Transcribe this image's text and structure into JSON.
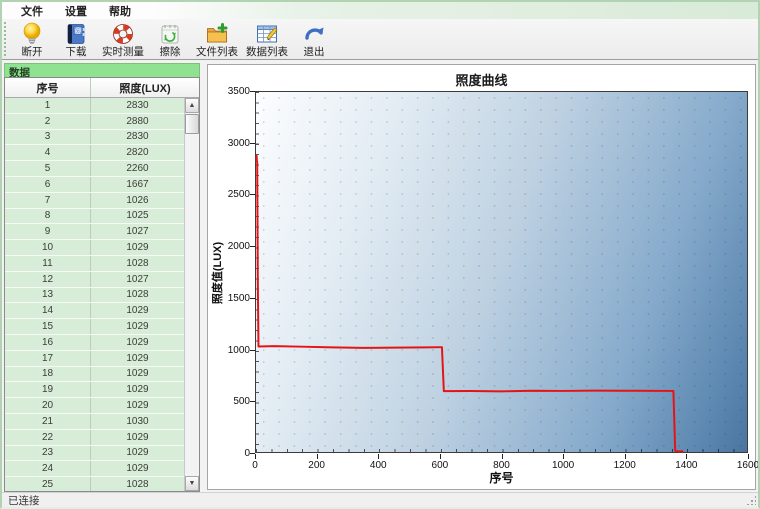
{
  "menu": {
    "items": [
      "文件",
      "设置",
      "帮助"
    ]
  },
  "toolbar": {
    "buttons": [
      {
        "label": "断开",
        "icon": "bulb-icon"
      },
      {
        "label": "下载",
        "icon": "book-icon"
      },
      {
        "label": "实时测量",
        "icon": "lifebuoy-icon"
      },
      {
        "label": "擦除",
        "icon": "erase-icon"
      },
      {
        "label": "文件列表",
        "icon": "folder-plus-icon"
      },
      {
        "label": "数据列表",
        "icon": "table-pencil-icon"
      },
      {
        "label": "退出",
        "icon": "exit-arrow-icon"
      }
    ]
  },
  "sidebar": {
    "title": "数据",
    "table": {
      "headers": [
        "序号",
        "照度(LUX)"
      ],
      "rows": [
        [
          1,
          2830
        ],
        [
          2,
          2880
        ],
        [
          3,
          2830
        ],
        [
          4,
          2820
        ],
        [
          5,
          2260
        ],
        [
          6,
          1667
        ],
        [
          7,
          1026
        ],
        [
          8,
          1025
        ],
        [
          9,
          1027
        ],
        [
          10,
          1029
        ],
        [
          11,
          1028
        ],
        [
          12,
          1027
        ],
        [
          13,
          1028
        ],
        [
          14,
          1029
        ],
        [
          15,
          1029
        ],
        [
          16,
          1029
        ],
        [
          17,
          1029
        ],
        [
          18,
          1029
        ],
        [
          19,
          1029
        ],
        [
          20,
          1029
        ],
        [
          21,
          1030
        ],
        [
          22,
          1029
        ],
        [
          23,
          1029
        ],
        [
          24,
          1029
        ],
        [
          25,
          1028
        ]
      ]
    }
  },
  "chart_data": {
    "type": "line",
    "title": "照度曲线",
    "xlabel": "序号",
    "ylabel": "照度值(LUX)",
    "xlim": [
      0,
      1600
    ],
    "ylim": [
      0,
      3500
    ],
    "x_ticks": [
      0,
      200,
      400,
      600,
      800,
      1000,
      1200,
      1400,
      1600
    ],
    "y_ticks": [
      0,
      500,
      1000,
      1500,
      2000,
      2500,
      3000,
      3500
    ],
    "grid": "dotted",
    "legend": "none",
    "line_color": "#e51414",
    "series": [
      {
        "name": "照度",
        "points": [
          [
            1,
            2830
          ],
          [
            2,
            2880
          ],
          [
            3,
            2830
          ],
          [
            4,
            2820
          ],
          [
            5,
            2260
          ],
          [
            6,
            1667
          ],
          [
            8,
            1026
          ],
          [
            60,
            1030
          ],
          [
            150,
            1024
          ],
          [
            250,
            1017
          ],
          [
            350,
            1012
          ],
          [
            450,
            1015
          ],
          [
            550,
            1017
          ],
          [
            600,
            1019
          ],
          [
            606,
            1019
          ],
          [
            612,
            592
          ],
          [
            700,
            593
          ],
          [
            800,
            590
          ],
          [
            900,
            596
          ],
          [
            1000,
            594
          ],
          [
            1100,
            597
          ],
          [
            1200,
            596
          ],
          [
            1300,
            595
          ],
          [
            1360,
            594
          ],
          [
            1366,
            12
          ],
          [
            1374,
            6
          ],
          [
            1392,
            6
          ]
        ]
      }
    ]
  },
  "statusbar": {
    "text": "已连接"
  }
}
